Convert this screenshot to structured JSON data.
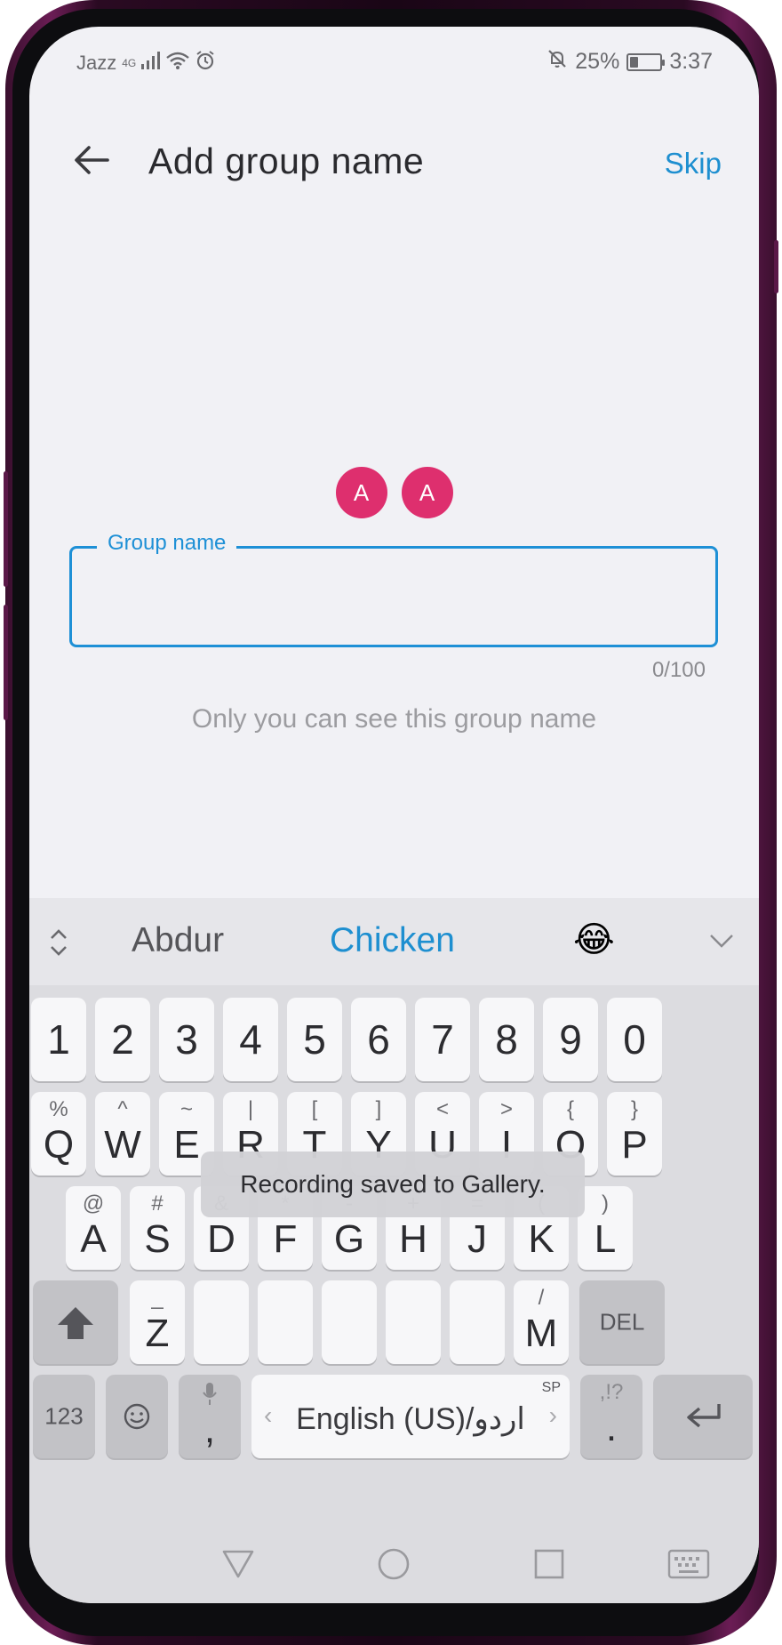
{
  "status_bar": {
    "carrier": "Jazz",
    "network_type": "4G",
    "battery_percent": "25%",
    "battery_level": 0.25,
    "time": "3:37"
  },
  "header": {
    "title": "Add group name",
    "skip_label": "Skip"
  },
  "avatars": [
    {
      "initial": "A",
      "color": "#de2f6e"
    },
    {
      "initial": "A",
      "color": "#de2f6e"
    }
  ],
  "group_name_input": {
    "label": "Group name",
    "value": "",
    "counter": "0/100"
  },
  "hint": "Only you can see this group name",
  "keyboard": {
    "suggestions": [
      "Abdur",
      "Chicken"
    ],
    "suggestion_emoji": "😂",
    "number_row": [
      "1",
      "2",
      "3",
      "4",
      "5",
      "6",
      "7",
      "8",
      "9",
      "0"
    ],
    "row1": [
      {
        "main": "Q",
        "sub": "%"
      },
      {
        "main": "W",
        "sub": "^"
      },
      {
        "main": "E",
        "sub": "~"
      },
      {
        "main": "R",
        "sub": "|"
      },
      {
        "main": "T",
        "sub": "["
      },
      {
        "main": "Y",
        "sub": "]"
      },
      {
        "main": "U",
        "sub": "<"
      },
      {
        "main": "I",
        "sub": ">"
      },
      {
        "main": "O",
        "sub": "{"
      },
      {
        "main": "P",
        "sub": "}"
      }
    ],
    "row2": [
      {
        "main": "A",
        "sub": "@"
      },
      {
        "main": "S",
        "sub": "#"
      },
      {
        "main": "D",
        "sub": "&"
      },
      {
        "main": "F",
        "sub": "*"
      },
      {
        "main": "G",
        "sub": "-"
      },
      {
        "main": "H",
        "sub": "+"
      },
      {
        "main": "J",
        "sub": "="
      },
      {
        "main": "K",
        "sub": "("
      },
      {
        "main": "L",
        "sub": ")"
      }
    ],
    "row3": [
      {
        "main": "Z",
        "sub": "_"
      },
      {
        "main": "M",
        "sub": "/"
      }
    ],
    "del_label": "DEL",
    "num_toggle_label": "123",
    "mic_key_label": ",",
    "space_label": "English (US)/اردو",
    "space_badge": "SP",
    "period_label": ".",
    "period_sub": ",!?"
  },
  "toast": "Recording saved to Gallery."
}
